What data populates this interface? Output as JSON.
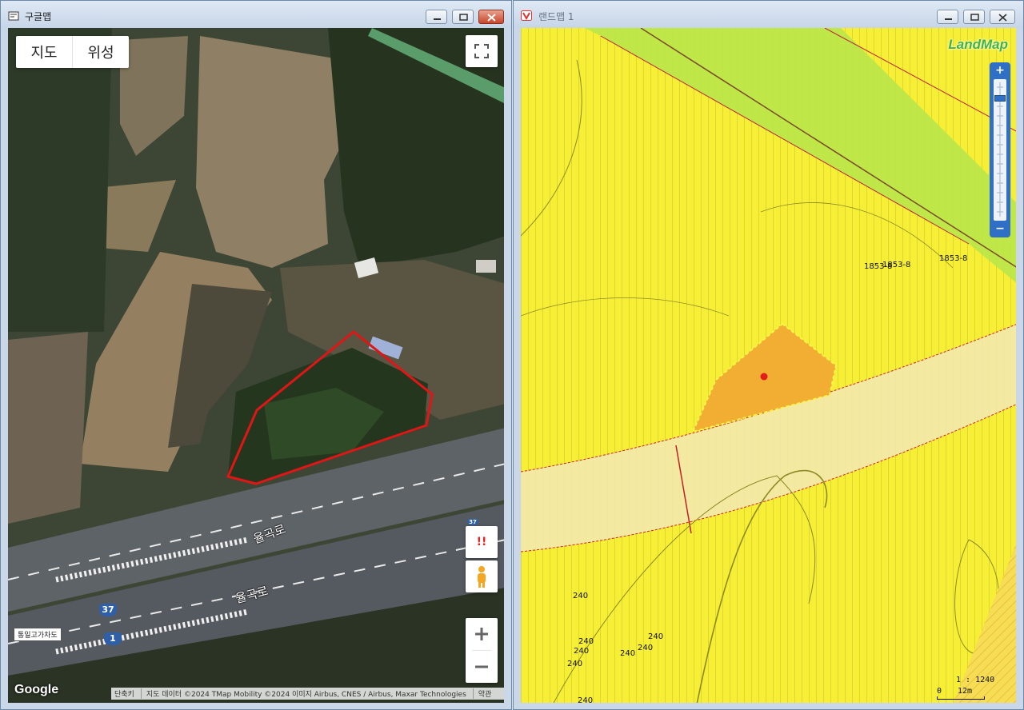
{
  "google_window": {
    "title": "구글맵",
    "map_type": {
      "map_label": "지도",
      "satellite_label": "위성"
    },
    "road_labels": [
      "율곡로",
      "율곡로"
    ],
    "route_shield": "37",
    "route_shield_2": "1",
    "bridge_label": "통일고가차도",
    "logo": "Google",
    "attribution": {
      "shortcuts": "단축키",
      "data": "지도 데이터 ©2024 TMap Mobility ©2024 이미지 Airbus, CNES / Airbus, Maxar Technologies",
      "terms": "약관"
    },
    "report_icon": "!!"
  },
  "land_window": {
    "title": "랜드맵 1",
    "logo": "LandMap",
    "parcel_labels": [
      "1853-8",
      "1853-8",
      "1853-8"
    ],
    "lot_numbers": [
      "240",
      "240",
      "240",
      "240",
      "240",
      "240",
      "240",
      "240"
    ],
    "scale_ratio": "1 : 1240",
    "scale_bar_start": "0",
    "scale_bar_end": "12m",
    "colors": {
      "zone_yellow": "#f7ef36",
      "zone_green": "#b9e64a",
      "road_tint": "#f3e7b3",
      "selected_parcel": "#f2ad33"
    }
  }
}
